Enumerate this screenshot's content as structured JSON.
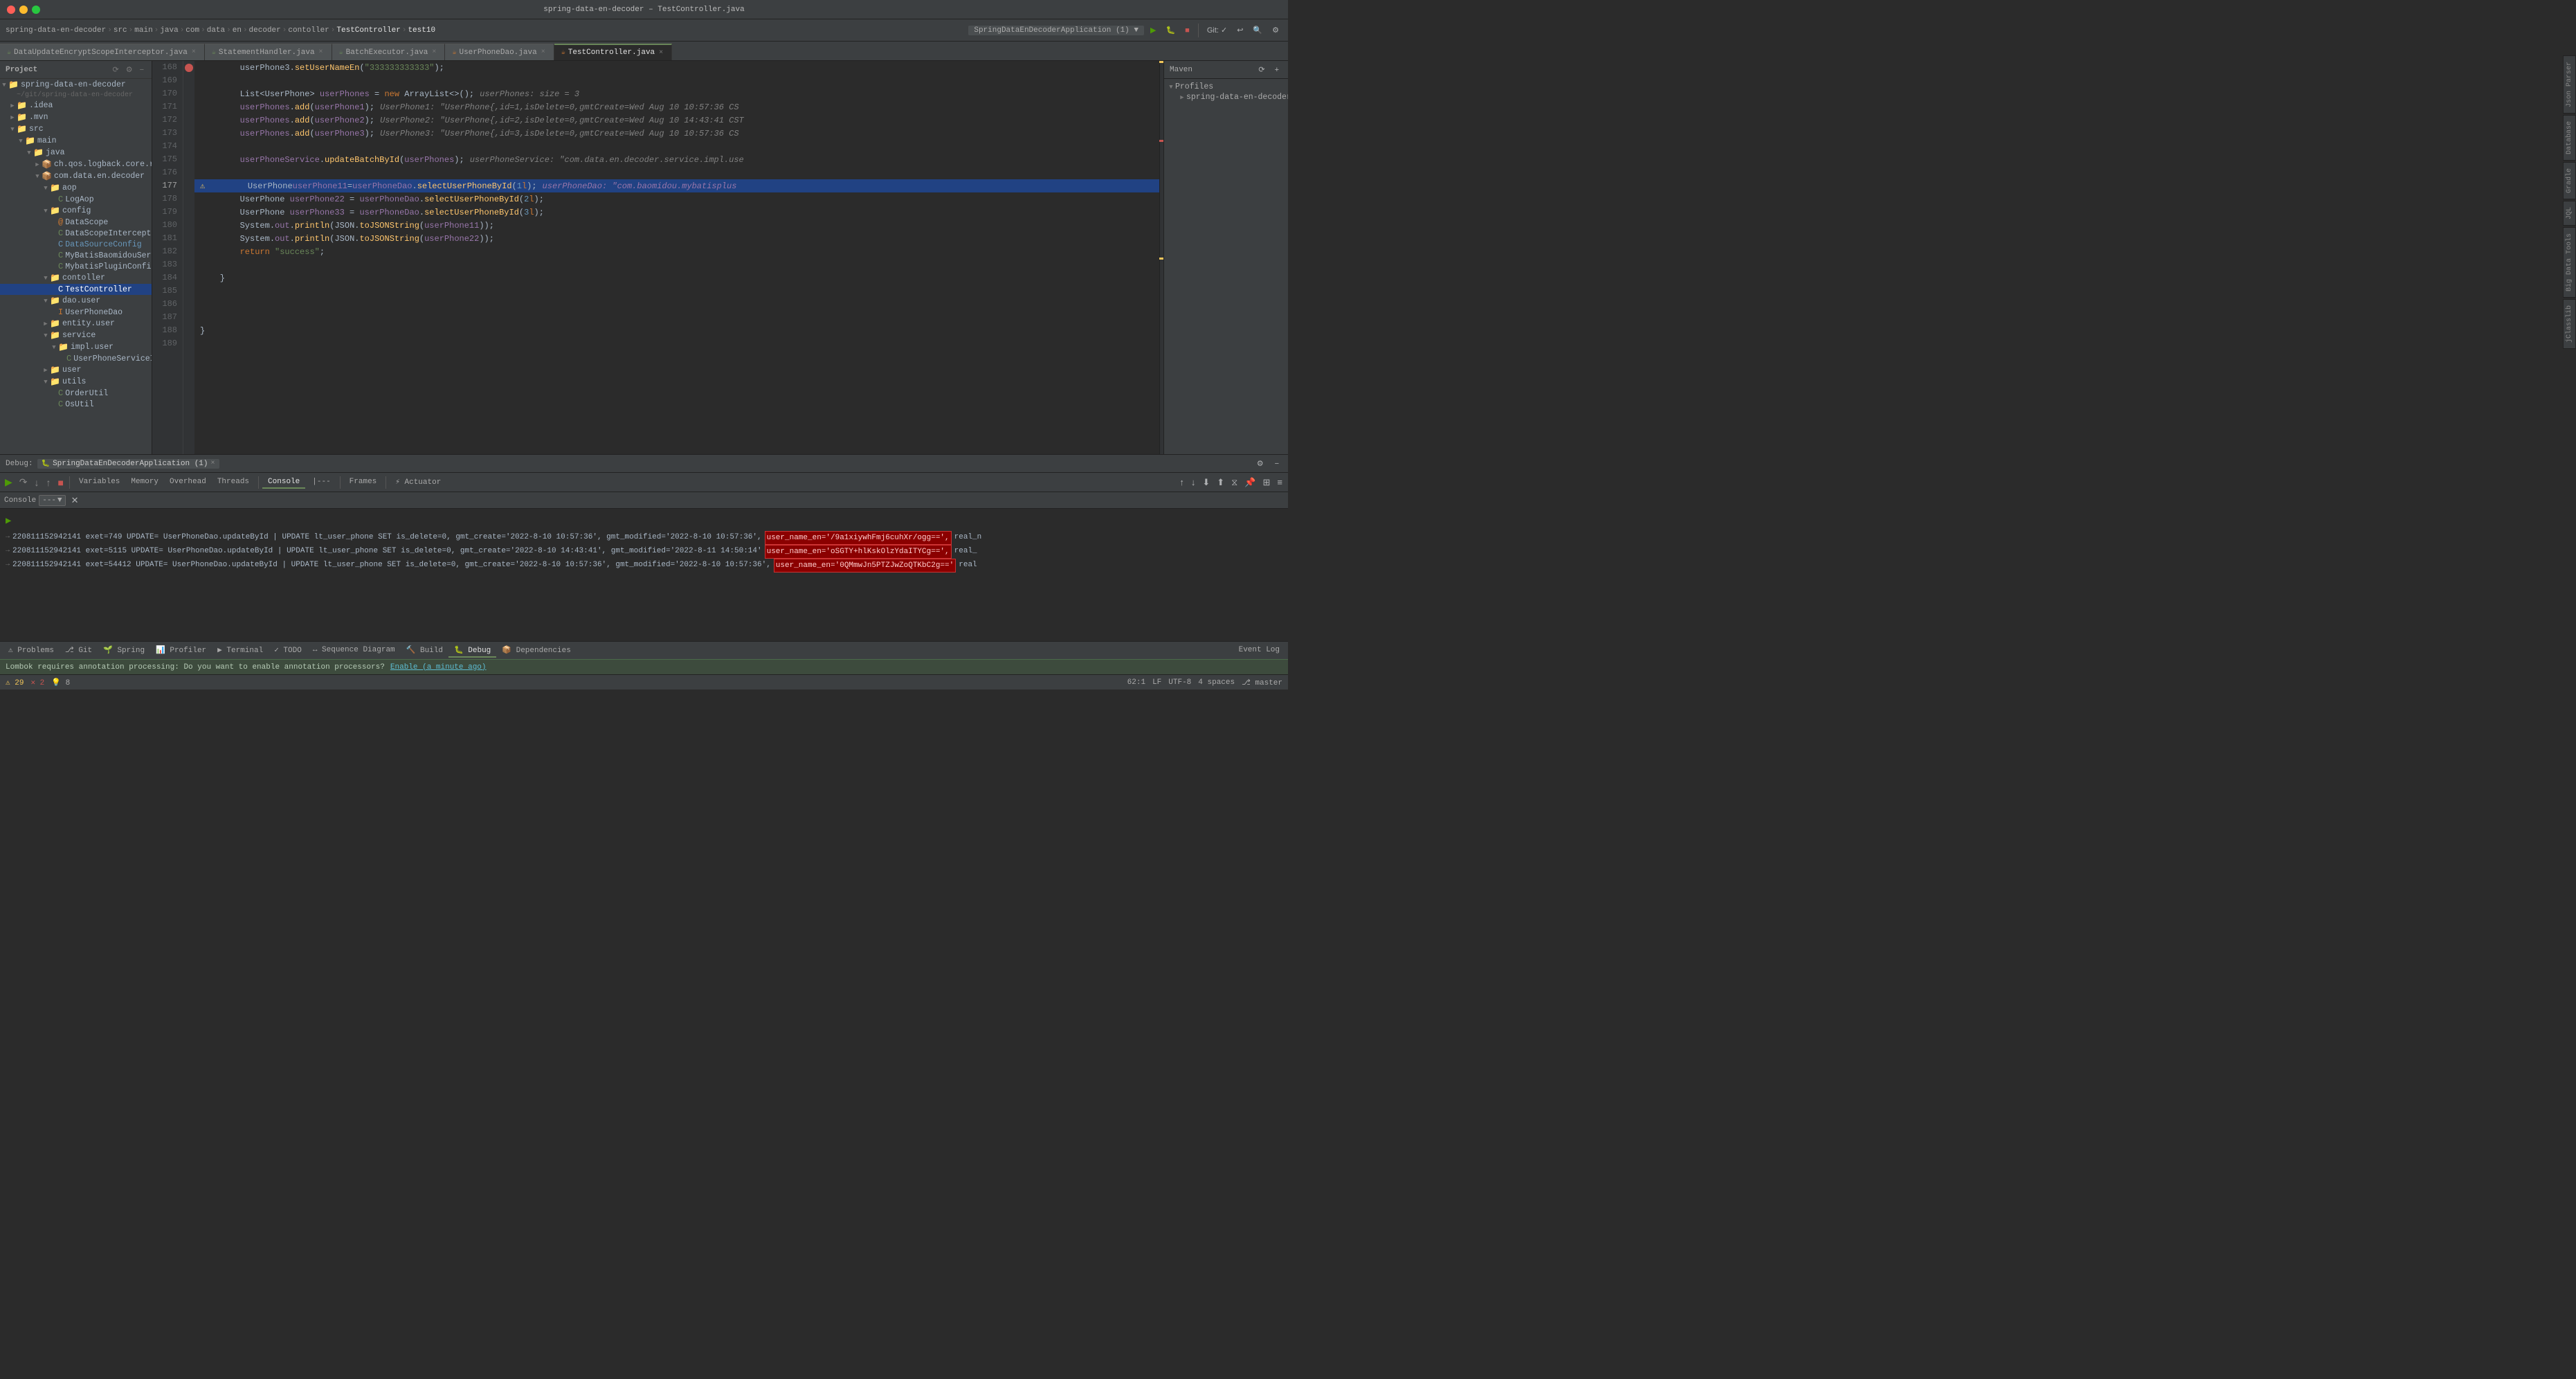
{
  "titleBar": {
    "title": "spring-data-en-decoder – TestController.java",
    "dots": [
      "red",
      "yellow",
      "green"
    ]
  },
  "breadcrumb": {
    "items": [
      "spring-data-en-decoder",
      "src",
      "main",
      "java",
      "com",
      "data",
      "en",
      "decoder",
      "contoller",
      "TestController",
      "test10"
    ]
  },
  "fileTabs": [
    {
      "name": "DataUpdateEncryptScopeInterceptor.java",
      "type": "java",
      "active": false
    },
    {
      "name": "StatementHandler.java",
      "type": "java",
      "active": false
    },
    {
      "name": "BatchExecutor.java",
      "type": "java",
      "active": false
    },
    {
      "name": "UserPhoneDao.java",
      "type": "java",
      "active": false
    },
    {
      "name": "TestController.java",
      "type": "java",
      "active": true
    }
  ],
  "sidebar": {
    "title": "Project",
    "root": "spring-data-en-decoder",
    "rootPath": "~/git/spring-data-en-decoder",
    "items": [
      {
        "label": ".idea",
        "type": "folder",
        "depth": 1,
        "expanded": false
      },
      {
        "label": ".mvn",
        "type": "folder",
        "depth": 1,
        "expanded": false
      },
      {
        "label": "src",
        "type": "folder",
        "depth": 1,
        "expanded": true
      },
      {
        "label": "main",
        "type": "folder",
        "depth": 2,
        "expanded": true
      },
      {
        "label": "java",
        "type": "folder",
        "depth": 3,
        "expanded": true
      },
      {
        "label": "ch.qos.logback.core.rolling",
        "type": "package",
        "depth": 4,
        "expanded": false
      },
      {
        "label": "com.data.en.decoder",
        "type": "package",
        "depth": 4,
        "expanded": true
      },
      {
        "label": "aop",
        "type": "folder",
        "depth": 5,
        "expanded": true
      },
      {
        "label": "LogAop",
        "type": "java",
        "depth": 6,
        "expanded": false
      },
      {
        "label": "config",
        "type": "folder",
        "depth": 5,
        "expanded": true
      },
      {
        "label": "DataScope",
        "type": "java",
        "depth": 6,
        "expanded": false
      },
      {
        "label": "DataScopeInterceptor",
        "type": "java",
        "depth": 6,
        "expanded": false
      },
      {
        "label": "DataSourceConfig",
        "type": "java",
        "depth": 6,
        "expanded": false,
        "selected": false,
        "color": "blue"
      },
      {
        "label": "MyBatisBaomidouServiceImpl",
        "type": "java",
        "depth": 6,
        "expanded": false
      },
      {
        "label": "MybatisPluginConfig",
        "type": "java",
        "depth": 6,
        "expanded": false
      },
      {
        "label": "contoller",
        "type": "folder",
        "depth": 5,
        "expanded": true
      },
      {
        "label": "TestController",
        "type": "java",
        "depth": 6,
        "selected": true
      },
      {
        "label": "dao.user",
        "type": "folder",
        "depth": 5,
        "expanded": true
      },
      {
        "label": "UserPhoneDao",
        "type": "java",
        "depth": 6,
        "expanded": false
      },
      {
        "label": "entity.user",
        "type": "folder",
        "depth": 5,
        "expanded": false
      },
      {
        "label": "service",
        "type": "folder",
        "depth": 5,
        "expanded": true
      },
      {
        "label": "impl.user",
        "type": "folder",
        "depth": 6,
        "expanded": true
      },
      {
        "label": "UserPhoneServiceImpl",
        "type": "java",
        "depth": 7,
        "expanded": false
      },
      {
        "label": "user",
        "type": "folder",
        "depth": 5,
        "expanded": false
      },
      {
        "label": "utils",
        "type": "folder",
        "depth": 5,
        "expanded": true
      },
      {
        "label": "OrderUtil",
        "type": "java",
        "depth": 6,
        "expanded": false
      },
      {
        "label": "OsUtil",
        "type": "java",
        "depth": 6,
        "expanded": false
      }
    ]
  },
  "codeLines": [
    {
      "num": 168,
      "content": "        userPhone3.setUserNameEn(\"333333333333\");",
      "type": "normal"
    },
    {
      "num": 169,
      "content": "",
      "type": "normal"
    },
    {
      "num": 170,
      "content": "        List<UserPhone> userPhones = new ArrayList<>();",
      "hint": "userPhones:  size = 3",
      "type": "normal"
    },
    {
      "num": 171,
      "content": "        userPhones.add(userPhone1);",
      "hint": "UserPhone1: \"UserPhone{,id=1,isDelete=0,gmtCreate=Wed Aug 10 10:57:36 CS",
      "type": "normal"
    },
    {
      "num": 172,
      "content": "        userPhones.add(userPhone2);",
      "hint": "UserPhone2: \"UserPhone{,id=2,isDelete=0,gmtCreate=Wed Aug 10 14:43:41 CST",
      "type": "normal"
    },
    {
      "num": 173,
      "content": "        userPhones.add(userPhone3);",
      "hint": "UserPhone3: \"UserPhone{,id=3,isDelete=0,gmtCreate=Wed Aug 10 10:57:36 CS",
      "type": "normal"
    },
    {
      "num": 174,
      "content": "",
      "type": "normal"
    },
    {
      "num": 175,
      "content": "        userPhoneService.updateBatchById(userPhones);",
      "hint": "userPhoneService: \"com.data.en.decoder.service.impl.use",
      "type": "normal"
    },
    {
      "num": 176,
      "content": "",
      "type": "normal"
    },
    {
      "num": 177,
      "content": "        UserPhone userPhone11 = userPhoneDao.selectUserPhoneById(1l);",
      "hint": "userPhoneDao: \"com.baomidou.mybatisplus",
      "type": "highlighted",
      "breakpoint": true,
      "warning": true
    },
    {
      "num": 178,
      "content": "        UserPhone userPhone22 = userPhoneDao.selectUserPhoneById(2l);",
      "type": "normal"
    },
    {
      "num": 179,
      "content": "        UserPhone userPhone33 = userPhoneDao.selectUserPhoneById(3l);",
      "type": "normal"
    },
    {
      "num": 180,
      "content": "        System.out.println(JSON.toJSONString(userPhone11));",
      "type": "normal"
    },
    {
      "num": 181,
      "content": "        System.out.println(JSON.toJSONString(userPhone22));",
      "type": "normal"
    },
    {
      "num": 182,
      "content": "        return \"success\";",
      "type": "normal"
    },
    {
      "num": 183,
      "content": "",
      "type": "normal"
    },
    {
      "num": 184,
      "content": "    }",
      "type": "normal"
    },
    {
      "num": 185,
      "content": "",
      "type": "normal"
    },
    {
      "num": 186,
      "content": "",
      "type": "normal"
    },
    {
      "num": 187,
      "content": "",
      "type": "normal"
    },
    {
      "num": 188,
      "content": "}",
      "type": "normal"
    },
    {
      "num": 189,
      "content": "",
      "type": "normal"
    }
  ],
  "debugPanel": {
    "title": "Debug:",
    "session": "SpringDataEnDecoderApplication (1)",
    "tabs": [
      {
        "label": "Variables",
        "active": false
      },
      {
        "label": "Memory",
        "active": false
      },
      {
        "label": "Overhead",
        "active": false
      },
      {
        "label": "Threads",
        "active": false
      }
    ],
    "consoleTabs": [
      {
        "label": "Console",
        "active": true
      },
      {
        "label": "|---",
        "active": false
      }
    ],
    "frames": "Frames",
    "actuator": "Actuator"
  },
  "console": {
    "label": "Console",
    "filter": "---",
    "lines": [
      {
        "icon": "arrow-right",
        "text": "220811152942141 exet=749 UPDATE= UserPhoneDao.updateById | UPDATE lt_user_phone SET is_delete=0, gmt_create='2022-8-10 10:57:36', gmt_modified='2022-8-10 10:57:36',",
        "highlight": "user_name_en='/9a1xiywhFmj6cuhXr/ogg==',",
        "suffix": " real_n"
      },
      {
        "icon": "arrow-right",
        "text": "220811152942141 exet=5115 UPDATE= UserPhoneDao.updateById | UPDATE lt_user_phone SET is_delete=0, gmt_create='2022-8-10 14:43:41', gmt_modified='2022-8-11 14:50:14'",
        "highlight": "user_name_en='oSGTY+hlKskOlzYdaITYCg==',",
        "suffix": " real_"
      },
      {
        "icon": "arrow-right",
        "text": "220811152942141 exet=54412 UPDATE= UserPhoneDao.updateById | UPDATE lt_user_phone SET is_delete=0, gmt_create='2022-8-10 10:57:36', gmt_modified='2022-8-10 10:57:36',",
        "highlight": "user_name_en='0QMmwJn5PTZJwZoQTKbC2g=='",
        "suffix": " real"
      }
    ]
  },
  "statusBar": {
    "position": "62:1",
    "encoding": "UTF-8",
    "indent": "4 spaces",
    "lineEnding": "LF",
    "branch": "master",
    "warnings": "29",
    "errors": "2",
    "hints": "8",
    "bottomTabs": [
      {
        "label": "Problems",
        "icon": "⚠"
      },
      {
        "label": "Git",
        "icon": "⎇"
      },
      {
        "label": "Spring",
        "icon": "🌱"
      },
      {
        "label": "Profiler",
        "icon": "📊"
      },
      {
        "label": "Terminal",
        "icon": "▶"
      },
      {
        "label": "TODO",
        "icon": "✓"
      },
      {
        "label": "Sequence Diagram",
        "icon": "↔"
      },
      {
        "label": "Build",
        "icon": "🔨"
      },
      {
        "label": "Debug",
        "icon": "🐛",
        "active": true
      },
      {
        "label": "Dependencies",
        "icon": "📦"
      }
    ],
    "eventLog": "Event Log"
  },
  "notification": {
    "text": "Lombok requires annotation processing: Do you want to enable annotation processors?",
    "link": "Enable (a minute ago)"
  },
  "mavenPanel": {
    "title": "Maven",
    "tabs": [
      "Maven",
      "Database",
      "Gradle",
      "JQL",
      "Big Data Tools",
      "jClasslib"
    ],
    "profiles": {
      "title": "Profiles",
      "item": "spring-data-en-decoder"
    }
  }
}
